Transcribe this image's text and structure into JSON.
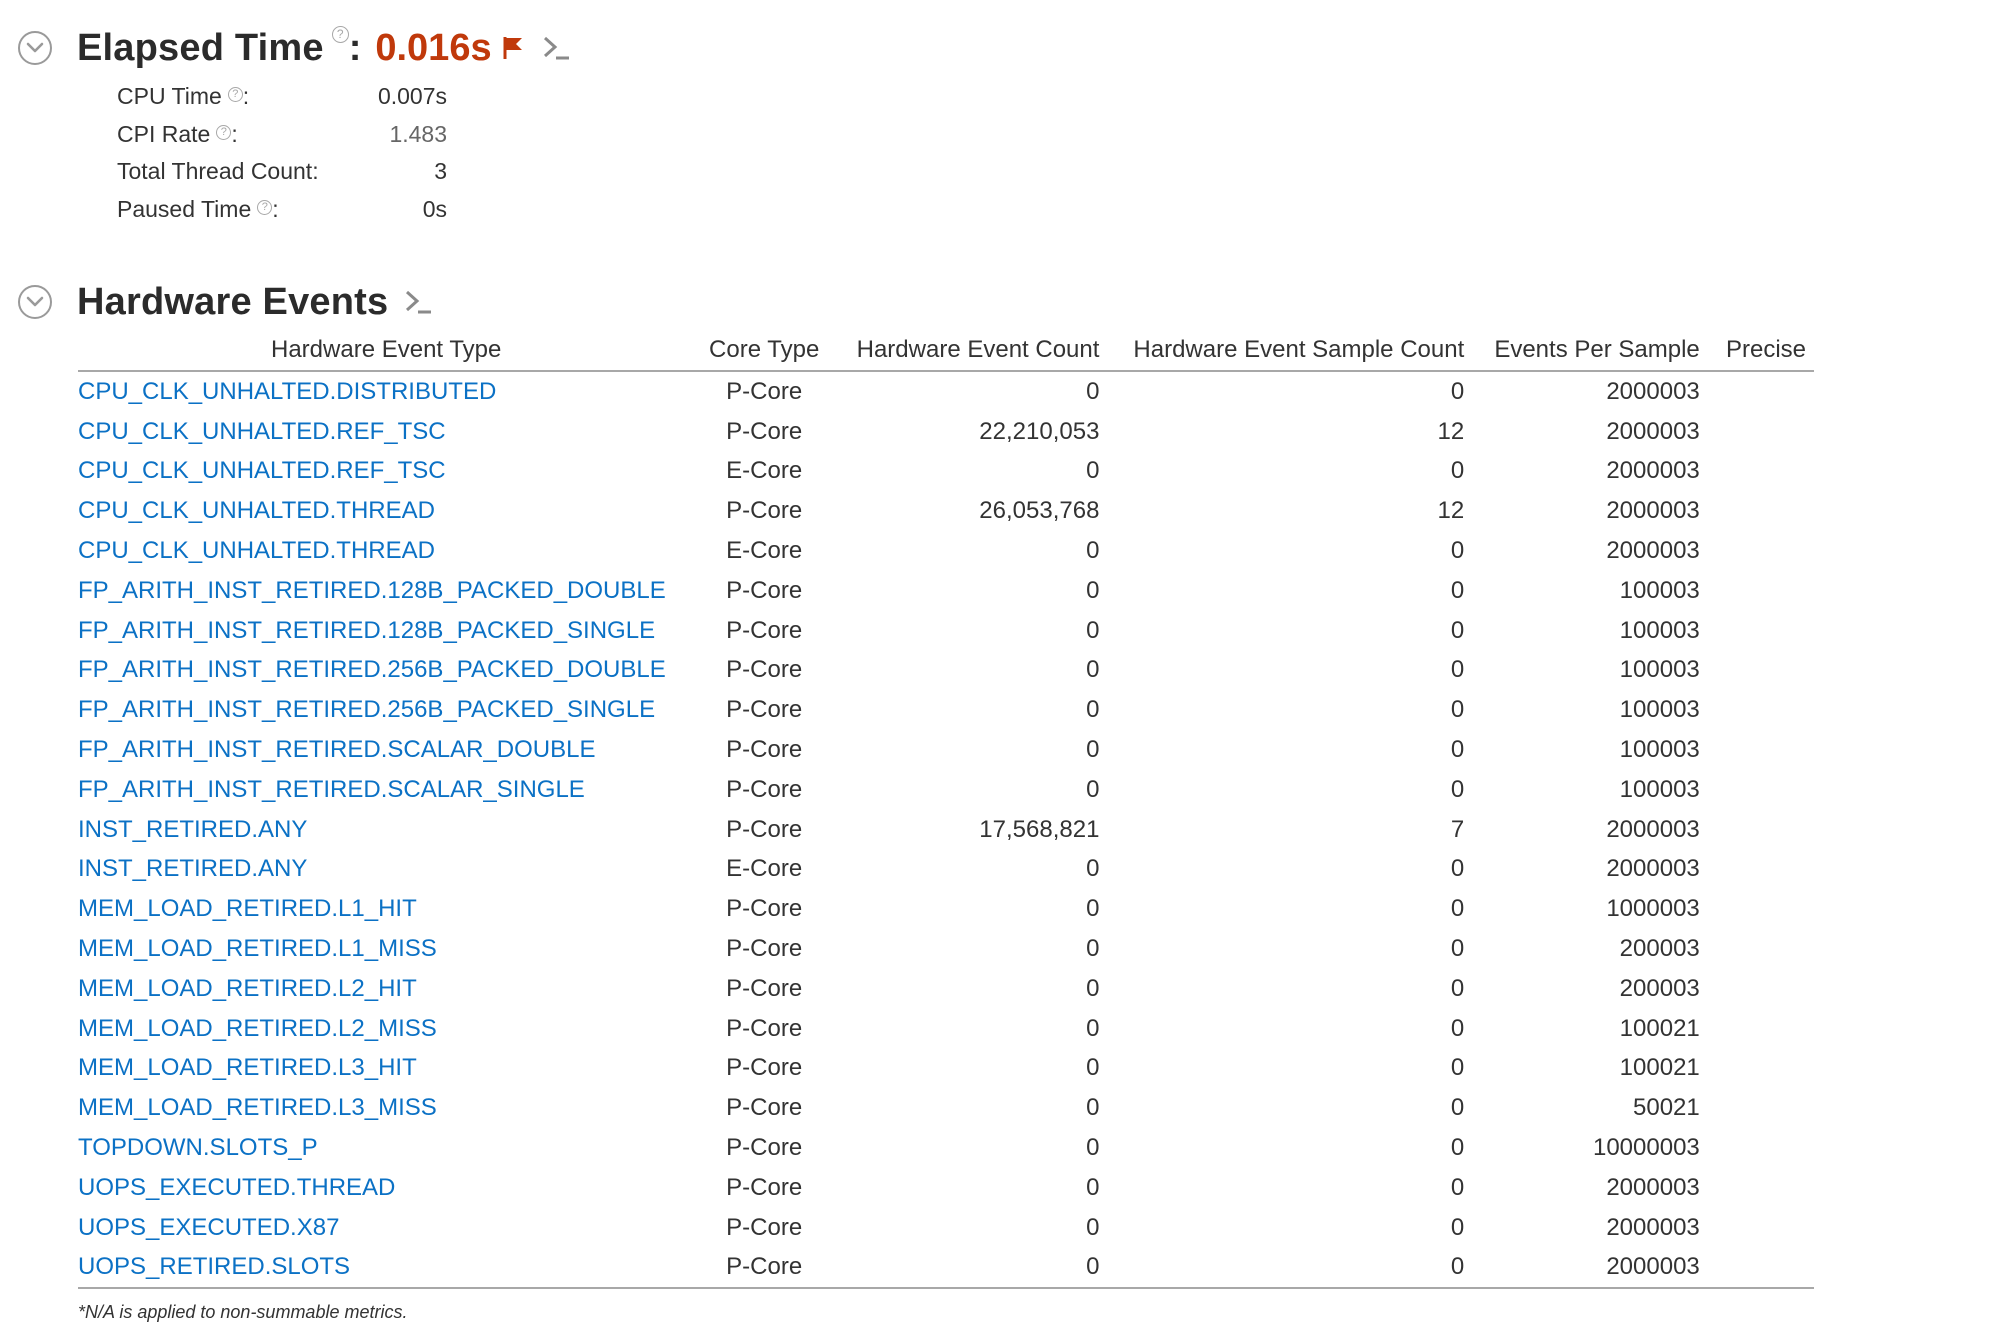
{
  "elapsed": {
    "title": "Elapsed Time",
    "colon": ":",
    "value": "0.016s",
    "help_glyph": "?",
    "value_color": "#c0390b"
  },
  "metrics": [
    {
      "label": "CPU Time",
      "has_help": true,
      "suffix": ":",
      "value": "0.007s"
    },
    {
      "label": "CPI Rate",
      "has_help": true,
      "suffix": ":",
      "value": "1.483"
    },
    {
      "label": "Total Thread Count:",
      "has_help": false,
      "suffix": "",
      "value": "3"
    },
    {
      "label": "Paused Time",
      "has_help": true,
      "suffix": ":",
      "value": "0s"
    }
  ],
  "hardware": {
    "title": "Hardware Events",
    "columns": [
      "Hardware Event Type",
      "Core Type",
      "Hardware Event Count",
      "Hardware Event Sample Count",
      "Events Per Sample",
      "Precise"
    ],
    "rows": [
      {
        "type": "CPU_CLK_UNHALTED.DISTRIBUTED",
        "core": "P-Core",
        "count": "0",
        "samples": "0",
        "per_sample": "2000003",
        "precise": ""
      },
      {
        "type": "CPU_CLK_UNHALTED.REF_TSC",
        "core": "P-Core",
        "count": "22,210,053",
        "samples": "12",
        "per_sample": "2000003",
        "precise": ""
      },
      {
        "type": "CPU_CLK_UNHALTED.REF_TSC",
        "core": "E-Core",
        "count": "0",
        "samples": "0",
        "per_sample": "2000003",
        "precise": ""
      },
      {
        "type": "CPU_CLK_UNHALTED.THREAD",
        "core": "P-Core",
        "count": "26,053,768",
        "samples": "12",
        "per_sample": "2000003",
        "precise": ""
      },
      {
        "type": "CPU_CLK_UNHALTED.THREAD",
        "core": "E-Core",
        "count": "0",
        "samples": "0",
        "per_sample": "2000003",
        "precise": ""
      },
      {
        "type": "FP_ARITH_INST_RETIRED.128B_PACKED_DOUBLE",
        "core": "P-Core",
        "count": "0",
        "samples": "0",
        "per_sample": "100003",
        "precise": ""
      },
      {
        "type": "FP_ARITH_INST_RETIRED.128B_PACKED_SINGLE",
        "core": "P-Core",
        "count": "0",
        "samples": "0",
        "per_sample": "100003",
        "precise": ""
      },
      {
        "type": "FP_ARITH_INST_RETIRED.256B_PACKED_DOUBLE",
        "core": "P-Core",
        "count": "0",
        "samples": "0",
        "per_sample": "100003",
        "precise": ""
      },
      {
        "type": "FP_ARITH_INST_RETIRED.256B_PACKED_SINGLE",
        "core": "P-Core",
        "count": "0",
        "samples": "0",
        "per_sample": "100003",
        "precise": ""
      },
      {
        "type": "FP_ARITH_INST_RETIRED.SCALAR_DOUBLE",
        "core": "P-Core",
        "count": "0",
        "samples": "0",
        "per_sample": "100003",
        "precise": ""
      },
      {
        "type": "FP_ARITH_INST_RETIRED.SCALAR_SINGLE",
        "core": "P-Core",
        "count": "0",
        "samples": "0",
        "per_sample": "100003",
        "precise": ""
      },
      {
        "type": "INST_RETIRED.ANY",
        "core": "P-Core",
        "count": "17,568,821",
        "samples": "7",
        "per_sample": "2000003",
        "precise": ""
      },
      {
        "type": "INST_RETIRED.ANY",
        "core": "E-Core",
        "count": "0",
        "samples": "0",
        "per_sample": "2000003",
        "precise": ""
      },
      {
        "type": "MEM_LOAD_RETIRED.L1_HIT",
        "core": "P-Core",
        "count": "0",
        "samples": "0",
        "per_sample": "1000003",
        "precise": ""
      },
      {
        "type": "MEM_LOAD_RETIRED.L1_MISS",
        "core": "P-Core",
        "count": "0",
        "samples": "0",
        "per_sample": "200003",
        "precise": ""
      },
      {
        "type": "MEM_LOAD_RETIRED.L2_HIT",
        "core": "P-Core",
        "count": "0",
        "samples": "0",
        "per_sample": "200003",
        "precise": ""
      },
      {
        "type": "MEM_LOAD_RETIRED.L2_MISS",
        "core": "P-Core",
        "count": "0",
        "samples": "0",
        "per_sample": "100021",
        "precise": ""
      },
      {
        "type": "MEM_LOAD_RETIRED.L3_HIT",
        "core": "P-Core",
        "count": "0",
        "samples": "0",
        "per_sample": "100021",
        "precise": ""
      },
      {
        "type": "MEM_LOAD_RETIRED.L3_MISS",
        "core": "P-Core",
        "count": "0",
        "samples": "0",
        "per_sample": "50021",
        "precise": ""
      },
      {
        "type": "TOPDOWN.SLOTS_P",
        "core": "P-Core",
        "count": "0",
        "samples": "0",
        "per_sample": "10000003",
        "precise": ""
      },
      {
        "type": "UOPS_EXECUTED.THREAD",
        "core": "P-Core",
        "count": "0",
        "samples": "0",
        "per_sample": "2000003",
        "precise": ""
      },
      {
        "type": "UOPS_EXECUTED.X87",
        "core": "P-Core",
        "count": "0",
        "samples": "0",
        "per_sample": "2000003",
        "precise": ""
      },
      {
        "type": "UOPS_RETIRED.SLOTS",
        "core": "P-Core",
        "count": "0",
        "samples": "0",
        "per_sample": "2000003",
        "precise": ""
      }
    ]
  },
  "footnote": "*N/A is applied to non-summable metrics.",
  "icons": {
    "collapse": "chevron-down-circle-icon",
    "flag": "flag-icon",
    "terminal": "terminal-icon",
    "help": "help-icon"
  },
  "colors": {
    "link": "#0b71c5",
    "accent": "#c0390b",
    "rule": "#a8a8a8"
  }
}
